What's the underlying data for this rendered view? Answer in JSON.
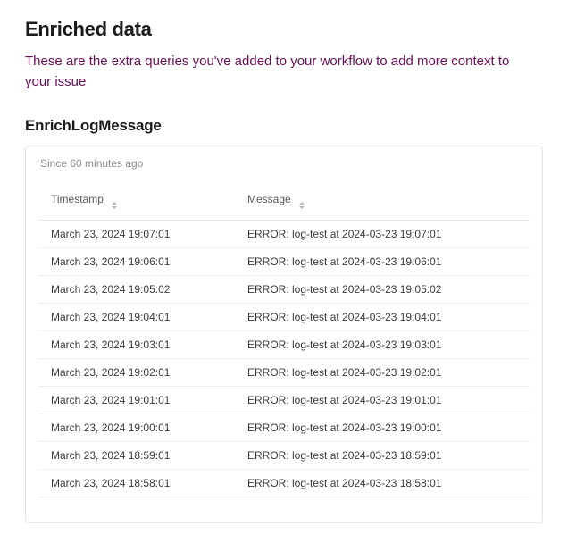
{
  "section_title": "Enriched data",
  "section_subtitle": "These are the extra queries you've added to your workflow to add more context to your issue",
  "query_name": "EnrichLogMessage",
  "card": {
    "since_label": "Since 60 minutes ago",
    "columns": {
      "timestamp": "Timestamp",
      "message": "Message"
    },
    "rows": [
      {
        "timestamp": "March 23, 2024 19:07:01",
        "message": "ERROR: log-test at 2024-03-23 19:07:01"
      },
      {
        "timestamp": "March 23, 2024 19:06:01",
        "message": "ERROR: log-test at 2024-03-23 19:06:01"
      },
      {
        "timestamp": "March 23, 2024 19:05:02",
        "message": "ERROR: log-test at 2024-03-23 19:05:02"
      },
      {
        "timestamp": "March 23, 2024 19:04:01",
        "message": "ERROR: log-test at 2024-03-23 19:04:01"
      },
      {
        "timestamp": "March 23, 2024 19:03:01",
        "message": "ERROR: log-test at 2024-03-23 19:03:01"
      },
      {
        "timestamp": "March 23, 2024 19:02:01",
        "message": "ERROR: log-test at 2024-03-23 19:02:01"
      },
      {
        "timestamp": "March 23, 2024 19:01:01",
        "message": "ERROR: log-test at 2024-03-23 19:01:01"
      },
      {
        "timestamp": "March 23, 2024 19:00:01",
        "message": "ERROR: log-test at 2024-03-23 19:00:01"
      },
      {
        "timestamp": "March 23, 2024 18:59:01",
        "message": "ERROR: log-test at 2024-03-23 18:59:01"
      },
      {
        "timestamp": "March 23, 2024 18:58:01",
        "message": "ERROR: log-test at 2024-03-23 18:58:01"
      }
    ]
  }
}
